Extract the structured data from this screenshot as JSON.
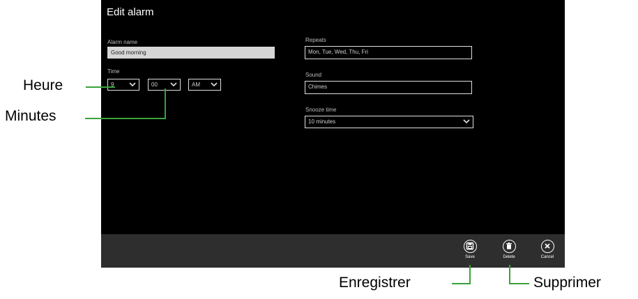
{
  "window": {
    "title": "Edit alarm"
  },
  "form": {
    "alarm_name_label": "Alarm name",
    "alarm_name_value": "Good morning",
    "time_label": "Time",
    "hour_value": "9",
    "minute_value": "00",
    "ampm_value": "AM",
    "repeats_label": "Repeats",
    "repeats_value": "Mon, Tue, Wed, Thu, Fri",
    "sound_label": "Sound",
    "sound_value": "Chimes",
    "snooze_label": "Snooze time",
    "snooze_value": "10 minutes"
  },
  "appbar": {
    "save_label": "Save",
    "delete_label": "Delete",
    "cancel_label": "Cancel"
  },
  "callouts": {
    "heure": "Heure",
    "minutes": "Minutes",
    "enregistrer": "Enregistrer",
    "supprimer": "Supprimer"
  },
  "colors": {
    "screen_bg": "#000000",
    "appbar_bg": "#2e2e2e",
    "callout_line": "#3aa23a"
  },
  "icons": [
    "chevron-down-icon",
    "save-icon",
    "delete-icon",
    "cancel-icon"
  ]
}
